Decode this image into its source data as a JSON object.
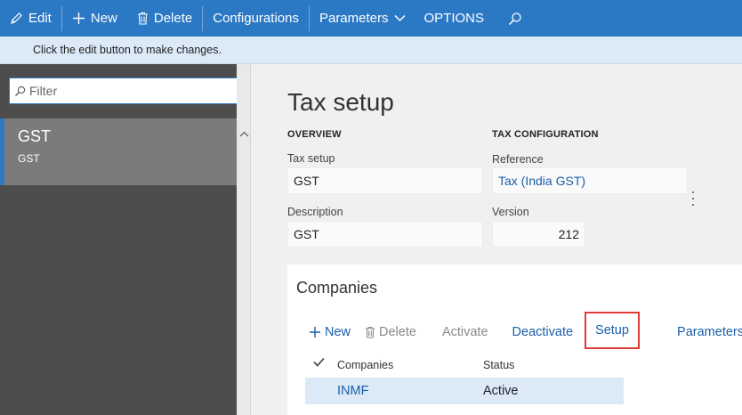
{
  "toolbar": {
    "edit": "Edit",
    "new": "New",
    "delete": "Delete",
    "configurations": "Configurations",
    "parameters": "Parameters",
    "options": "OPTIONS",
    "search_icon": "search-icon"
  },
  "message": "Click the edit button to make changes.",
  "filter": {
    "placeholder": "Filter",
    "value": ""
  },
  "list": [
    {
      "title": "GST",
      "subtitle": "GST"
    }
  ],
  "page": {
    "title": "Tax setup",
    "overview": {
      "heading": "OVERVIEW",
      "tax_setup_label": "Tax setup",
      "tax_setup_value": "GST",
      "description_label": "Description",
      "description_value": "GST"
    },
    "tax_configuration": {
      "heading": "TAX CONFIGURATION",
      "reference_label": "Reference",
      "reference_value": "Tax (India GST)",
      "version_label": "Version",
      "version_value": "212"
    }
  },
  "companies": {
    "title": "Companies",
    "toolbar": {
      "new": "New",
      "delete": "Delete",
      "activate": "Activate",
      "deactivate": "Deactivate",
      "setup": "Setup",
      "parameters": "Parameters"
    },
    "columns": {
      "companies": "Companies",
      "status": "Status"
    },
    "rows": [
      {
        "company": "INMF",
        "status": "Active"
      }
    ]
  },
  "colors": {
    "accent": "#2b78c4",
    "link": "#1a5ea8",
    "highlight_box": "#e03b3b",
    "message_bar": "#dce9f7"
  }
}
